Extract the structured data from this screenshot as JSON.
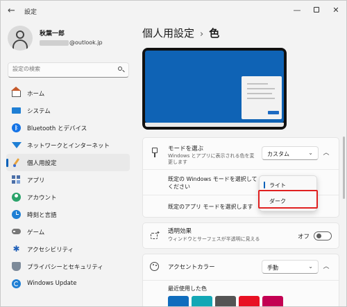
{
  "window": {
    "app_title": "設定",
    "controls": {
      "minimize": "—",
      "close": "✕"
    }
  },
  "profile": {
    "name": "秋葉一郎",
    "email_suffix": "@outlook.jp"
  },
  "search": {
    "placeholder": "設定の検索"
  },
  "sidebar": {
    "items": [
      {
        "label": "ホーム",
        "icon": "home-icon"
      },
      {
        "label": "システム",
        "icon": "system-icon"
      },
      {
        "label": "Bluetooth とデバイス",
        "icon": "bluetooth-icon"
      },
      {
        "label": "ネットワークとインターネット",
        "icon": "network-icon"
      },
      {
        "label": "個人用設定",
        "icon": "personalization-icon",
        "active": true
      },
      {
        "label": "アプリ",
        "icon": "apps-icon"
      },
      {
        "label": "アカウント",
        "icon": "account-icon"
      },
      {
        "label": "時刻と言語",
        "icon": "clock-icon"
      },
      {
        "label": "ゲーム",
        "icon": "gamepad-icon"
      },
      {
        "label": "アクセシビリティ",
        "icon": "accessibility-icon"
      },
      {
        "label": "プライバシーとセキュリティ",
        "icon": "shield-icon"
      },
      {
        "label": "Windows Update",
        "icon": "update-icon"
      }
    ],
    "accent_color": "#005fb8"
  },
  "main": {
    "breadcrumb_parent": "個人用設定",
    "breadcrumb_separator": "›",
    "breadcrumb_current": "色",
    "mode_card": {
      "title": "モードを選ぶ",
      "description": "Windows とアプリに表示される色を変更します",
      "dropdown_value": "カスタム",
      "windows_mode_label": "既定の Windows モードを選択してください",
      "app_mode_label": "既定のアプリ モードを選択します",
      "menu_options": [
        "ライト",
        "ダーク"
      ],
      "menu_selected": "ライト",
      "highlighted_option": "ダーク"
    },
    "transparency_card": {
      "title": "透明効果",
      "description": "ウィンドウとサーフェスが半透明に見える",
      "toggle_label": "オフ",
      "toggle_on": false
    },
    "accent_card": {
      "title": "アクセントカラー",
      "dropdown_value": "手動",
      "recent_colors_label": "最近使用した色",
      "recent_colors": [
        "#0f6cbd",
        "#13a7b5",
        "#545454",
        "#e81123",
        "#c30052"
      ]
    },
    "preview_colors": {
      "desktop": "#0f63b5",
      "frame": "#111111"
    }
  }
}
